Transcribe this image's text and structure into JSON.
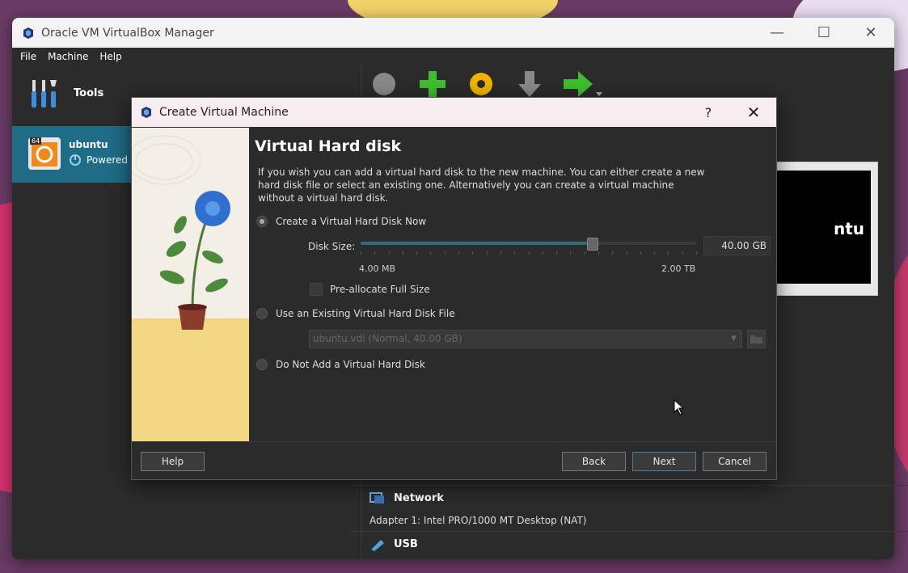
{
  "main_window": {
    "title": "Oracle VM VirtualBox Manager",
    "minimize": "—",
    "maximize": "☐",
    "close": "✕",
    "menu": [
      "File",
      "Machine",
      "Help"
    ]
  },
  "sidebar": {
    "tools_label": "Tools",
    "vm": {
      "name": "ubuntu",
      "state": "Powered",
      "arch_badge": "64"
    }
  },
  "preview": {
    "text": "ntu"
  },
  "details": {
    "network_title": "Network",
    "network_adapter": "Adapter 1:   Intel PRO/1000 MT Desktop (NAT)",
    "usb_title": "USB"
  },
  "dialog": {
    "title": "Create Virtual Machine",
    "help_glyph": "?",
    "close_glyph": "✕",
    "heading": "Virtual Hard disk",
    "description": "If you wish you can add a virtual hard disk to the new machine. You can either create a new hard disk file or select an existing one. Alternatively you can create a virtual machine without a virtual hard disk.",
    "options": {
      "create_now": "Create a Virtual Hard Disk Now",
      "use_existing": "Use an Existing Virtual Hard Disk File",
      "do_not_add": "Do Not Add a Virtual Hard Disk"
    },
    "selected_option": "create_now",
    "disk_size_label": "Disk Size:",
    "disk_size_value": "40.00 GB",
    "disk_size_fraction": 0.69,
    "slider_min": "4.00 MB",
    "slider_max": "2.00 TB",
    "preallocate_label": "Pre-allocate Full Size",
    "preallocate_checked": false,
    "existing_file": "ubuntu.vdi (Normal, 40.00 GB)",
    "buttons": {
      "help": "Help",
      "back": "Back",
      "next": "Next",
      "cancel": "Cancel"
    }
  },
  "colors": {
    "accent": "#1e6c86",
    "slider_fill": "#2c6f78",
    "green": "#3fbf2f",
    "yellow": "#f0b400"
  }
}
